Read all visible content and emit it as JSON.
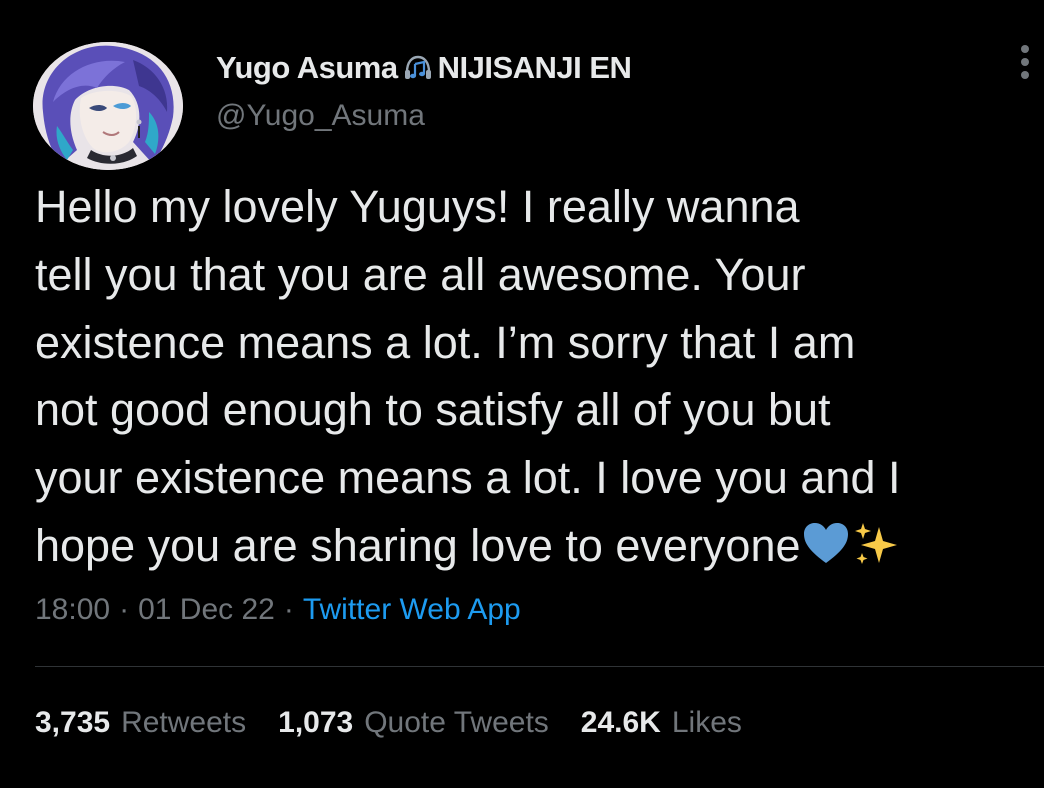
{
  "author": {
    "display_name": "Yugo Asuma",
    "affiliation": "NIJISANJI EN",
    "handle": "@Yugo_Asuma"
  },
  "icons": {
    "avatar": "avatar-illustration",
    "name_badge": "headphones-music-note-icon",
    "more": "more-options-icon",
    "emoji_1": "blue-heart-emoji",
    "emoji_2": "sparkles-emoji"
  },
  "tweet": {
    "lines": [
      "Hello my lovely Yuguys! I really wanna",
      "tell you that you are all awesome. Your",
      "existence means a lot. I’m sorry that I am",
      "not good enough to satisfy all of you but",
      "your existence means a lot. I love you and I",
      "hope you are sharing love to everyone"
    ]
  },
  "meta": {
    "time": "18:00",
    "date": "01 Dec 22",
    "separator": "·",
    "source": "Twitter Web App"
  },
  "stats": {
    "retweets_count": "3,735",
    "retweets_label": "Retweets",
    "quotes_count": "1,073",
    "quotes_label": "Quote Tweets",
    "likes_count": "24.6K",
    "likes_label": "Likes"
  },
  "colors": {
    "background": "#000000",
    "primary_text": "#e7e9ea",
    "secondary_text": "#71767b",
    "link": "#1d9bf0",
    "divider": "#2f3336",
    "heart": "#5b9bd5",
    "sparkle": "#f7c948"
  }
}
